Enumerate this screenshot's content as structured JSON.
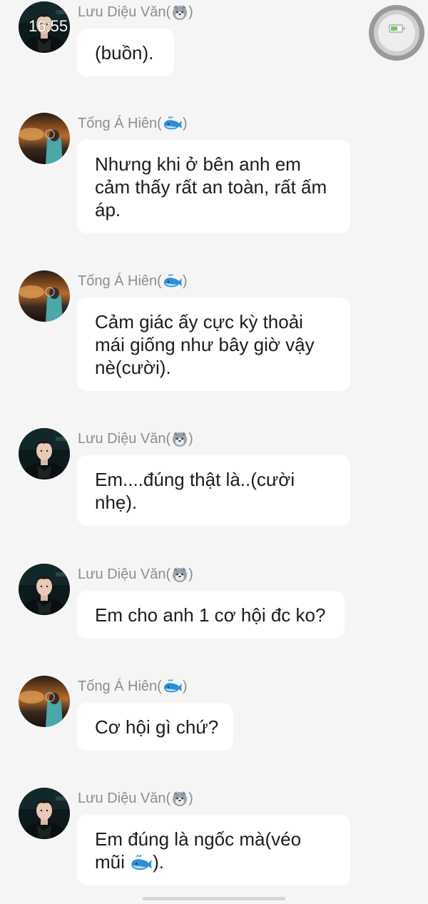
{
  "status": {
    "time": "16:55",
    "battery_color": "#6ad14f"
  },
  "senders": {
    "luu": {
      "name": "Lưu Diệu Văn(",
      "close": ")",
      "emoji": "wolf-icon"
    },
    "tong": {
      "name": "Tống Á Hiên(",
      "close": ")",
      "emoji": "whale-icon"
    }
  },
  "messages": [
    {
      "sender": "Lưu Diệu Văn(",
      "close": ")",
      "text": "(buồn)."
    },
    {
      "sender": "Tống Á Hiên(",
      "close": ")",
      "text": "Nhưng khi ở bên anh em cảm thấy rất an toàn, rất ấm áp."
    },
    {
      "sender": "Tống Á Hiên(",
      "close": ")",
      "text": "Cảm giác ấy cực kỳ thoải mái giống như bây giờ vậy nè(cười)."
    },
    {
      "sender": "Lưu Diệu Văn(",
      "close": ")",
      "text": "Em....đúng thật là..(cười nhẹ)."
    },
    {
      "sender": "Lưu Diệu Văn(",
      "close": ")",
      "text": "Em cho anh 1 cơ hội đc ko?"
    },
    {
      "sender": "Tống Á Hiên(",
      "close": ")",
      "text": "Cơ hội gì chứ?"
    },
    {
      "sender": "Lưu Diệu Văn(",
      "close": ")",
      "text_before": "Em đúng là ngốc mà(véo mũi ",
      "text_after": ")."
    }
  ],
  "colors": {
    "background": "#f5f5f5",
    "bubble": "#ffffff",
    "sender_text": "#8d8d8d",
    "message_text": "#1c1c1c"
  }
}
